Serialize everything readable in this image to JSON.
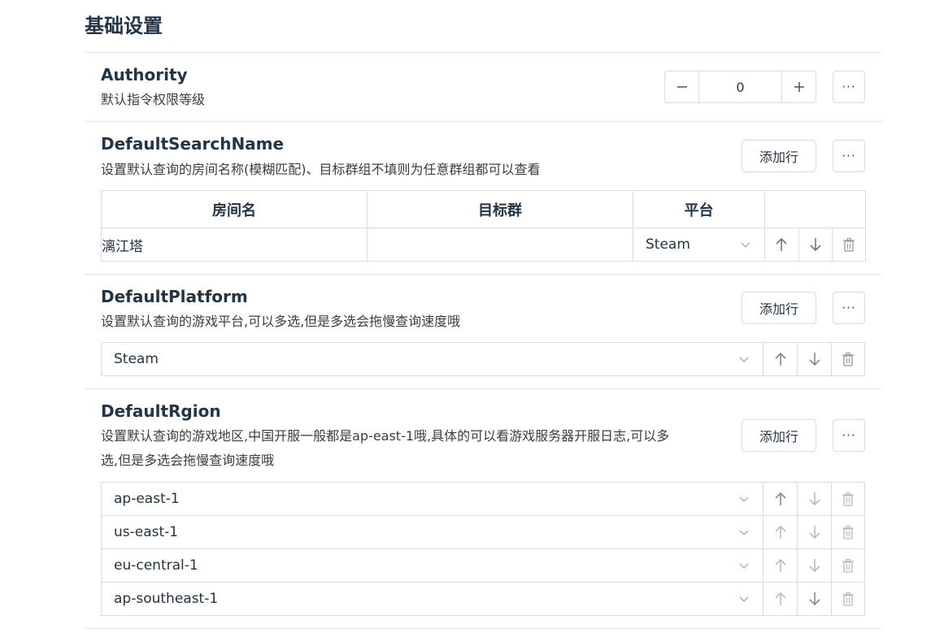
{
  "page": {
    "title": "基础设置"
  },
  "common": {
    "add_row": "添加行",
    "more": "···"
  },
  "authority": {
    "title": "Authority",
    "desc": "默认指令权限等级",
    "value": "0",
    "minus": "−",
    "plus": "+"
  },
  "search_name": {
    "title": "DefaultSearchName",
    "desc": "设置默认查询的房间名称(模糊匹配)、目标群组不填则为任意群组都可以查看",
    "columns": [
      "房间名",
      "目标群",
      "平台"
    ],
    "rows": [
      {
        "room": "漓江塔",
        "group": "",
        "platform": "Steam"
      }
    ]
  },
  "platform": {
    "title": "DefaultPlatform",
    "desc": "设置默认查询的游戏平台,可以多选,但是多选会拖慢查询速度哦",
    "items": [
      "Steam"
    ]
  },
  "region": {
    "title": "DefaultRgion",
    "desc_line1": "设置默认查询的游戏地区,中国开服一般都是ap-east-1哦,具体的可以看游戏服务器开服日志,可以多",
    "desc_line2": "选,但是多选会拖慢查询速度哦",
    "items": [
      "ap-east-1",
      "us-east-1",
      "eu-central-1",
      "ap-southeast-1"
    ]
  },
  "colors": {
    "text": "#213547",
    "border": "#dcdcdf",
    "icon": "#8a8a8f"
  }
}
